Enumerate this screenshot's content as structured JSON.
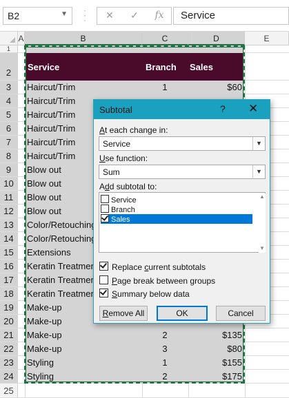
{
  "name_box": "B2",
  "formula_bar": {
    "content": "Service",
    "fx_label": "fx"
  },
  "columns": [
    "A",
    "B",
    "C",
    "D",
    "E"
  ],
  "rows": [
    "1",
    "2",
    "3",
    "4",
    "5",
    "6",
    "7",
    "8",
    "9",
    "10",
    "11",
    "12",
    "13",
    "14",
    "15",
    "16",
    "17",
    "18",
    "19",
    "20",
    "21",
    "22",
    "23",
    "24",
    "25"
  ],
  "table_header": {
    "service": "Service",
    "branch": "Branch",
    "sales": "Sales"
  },
  "table": [
    {
      "row": "3",
      "service": "Haircut/Trim",
      "branch": "1",
      "sales": "$60"
    },
    {
      "row": "4",
      "service": "Haircut/Trim",
      "branch": "",
      "sales": ""
    },
    {
      "row": "5",
      "service": "Haircut/Trim",
      "branch": "",
      "sales": ""
    },
    {
      "row": "6",
      "service": "Haircut/Trim",
      "branch": "",
      "sales": ""
    },
    {
      "row": "7",
      "service": "Haircut/Trim",
      "branch": "",
      "sales": ""
    },
    {
      "row": "8",
      "service": "Haircut/Trim",
      "branch": "",
      "sales": ""
    },
    {
      "row": "9",
      "service": "Blow out",
      "branch": "",
      "sales": ""
    },
    {
      "row": "10",
      "service": "Blow out",
      "branch": "",
      "sales": ""
    },
    {
      "row": "11",
      "service": "Blow out",
      "branch": "",
      "sales": ""
    },
    {
      "row": "12",
      "service": "Blow out",
      "branch": "",
      "sales": ""
    },
    {
      "row": "13",
      "service": "Color/Retouching",
      "branch": "",
      "sales": ""
    },
    {
      "row": "14",
      "service": "Color/Retouching",
      "branch": "",
      "sales": ""
    },
    {
      "row": "15",
      "service": "Extensions",
      "branch": "",
      "sales": ""
    },
    {
      "row": "16",
      "service": "Keratin Treatment",
      "branch": "",
      "sales": ""
    },
    {
      "row": "17",
      "service": "Keratin Treatment",
      "branch": "",
      "sales": ""
    },
    {
      "row": "18",
      "service": "Keratin Treatment",
      "branch": "",
      "sales": ""
    },
    {
      "row": "19",
      "service": "Make-up",
      "branch": "",
      "sales": ""
    },
    {
      "row": "20",
      "service": "Make-up",
      "branch": "",
      "sales": ""
    },
    {
      "row": "21",
      "service": "Make-up",
      "branch": "2",
      "sales": "$135"
    },
    {
      "row": "22",
      "service": "Make-up",
      "branch": "3",
      "sales": "$80"
    },
    {
      "row": "23",
      "service": "Styling",
      "branch": "1",
      "sales": "$155"
    },
    {
      "row": "24",
      "service": "Styling",
      "branch": "2",
      "sales": "$175"
    }
  ],
  "dialog": {
    "title": "Subtotal",
    "help": "?",
    "close": "✕",
    "change_label_pre": "",
    "change_label_u": "A",
    "change_label_post": "t each change in:",
    "change_value": "Service",
    "function_label_u": "U",
    "function_label_post": "se function:",
    "function_value": "Sum",
    "add_label_pre": "A",
    "add_label_u": "d",
    "add_label_post": "d subtotal to:",
    "subtotal_fields": [
      {
        "label": "Service",
        "checked": false,
        "selected": false
      },
      {
        "label": "Branch",
        "checked": false,
        "selected": false
      },
      {
        "label": "Sales",
        "checked": true,
        "selected": true
      }
    ],
    "replace_pre": "Replace ",
    "replace_u": "c",
    "replace_post": "urrent subtotals",
    "replace_checked": true,
    "pagebreak_u": "P",
    "pagebreak_post": "age break between groups",
    "pagebreak_checked": false,
    "summary_u": "S",
    "summary_post": "ummary below data",
    "summary_checked": true,
    "remove_all_u": "R",
    "remove_all_post": "emove All",
    "ok": "OK",
    "cancel": "Cancel"
  },
  "colors": {
    "header_fill": "#4a0a2a",
    "dialog_title": "#1ba1c0",
    "selection": "#217346"
  }
}
